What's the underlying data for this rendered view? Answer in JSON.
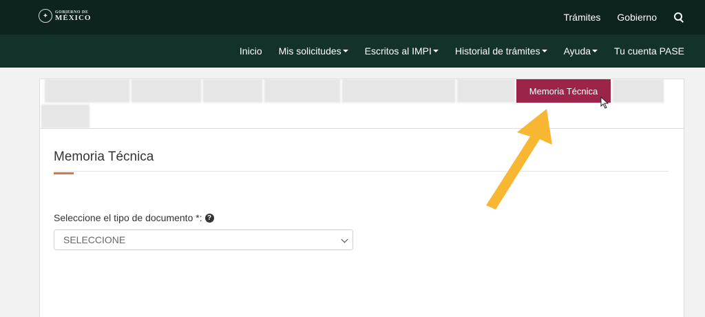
{
  "header": {
    "logo_line1": "GOBIERNO DE",
    "logo_line2": "MÉXICO",
    "links": [
      "Trámites",
      "Gobierno"
    ]
  },
  "nav": {
    "items": [
      {
        "label": "Inicio",
        "dropdown": false
      },
      {
        "label": "Mis solicitudes",
        "dropdown": true
      },
      {
        "label": "Escritos al IMPI",
        "dropdown": true
      },
      {
        "label": "Historial de trámites",
        "dropdown": true
      },
      {
        "label": "Ayuda",
        "dropdown": true
      },
      {
        "label": "Tu cuenta PASE",
        "dropdown": false
      }
    ]
  },
  "tabs": {
    "active_label": "Memoria Técnica"
  },
  "section": {
    "title": "Memoria Técnica"
  },
  "form": {
    "doc_type_label": "Seleccione el tipo de documento *:",
    "doc_type_value": "SELECCIONE"
  },
  "colors": {
    "header_bg": "#0c231e",
    "nav_bg": "#13322b",
    "active_tab": "#9d2449",
    "arrow": "#f7b733"
  }
}
